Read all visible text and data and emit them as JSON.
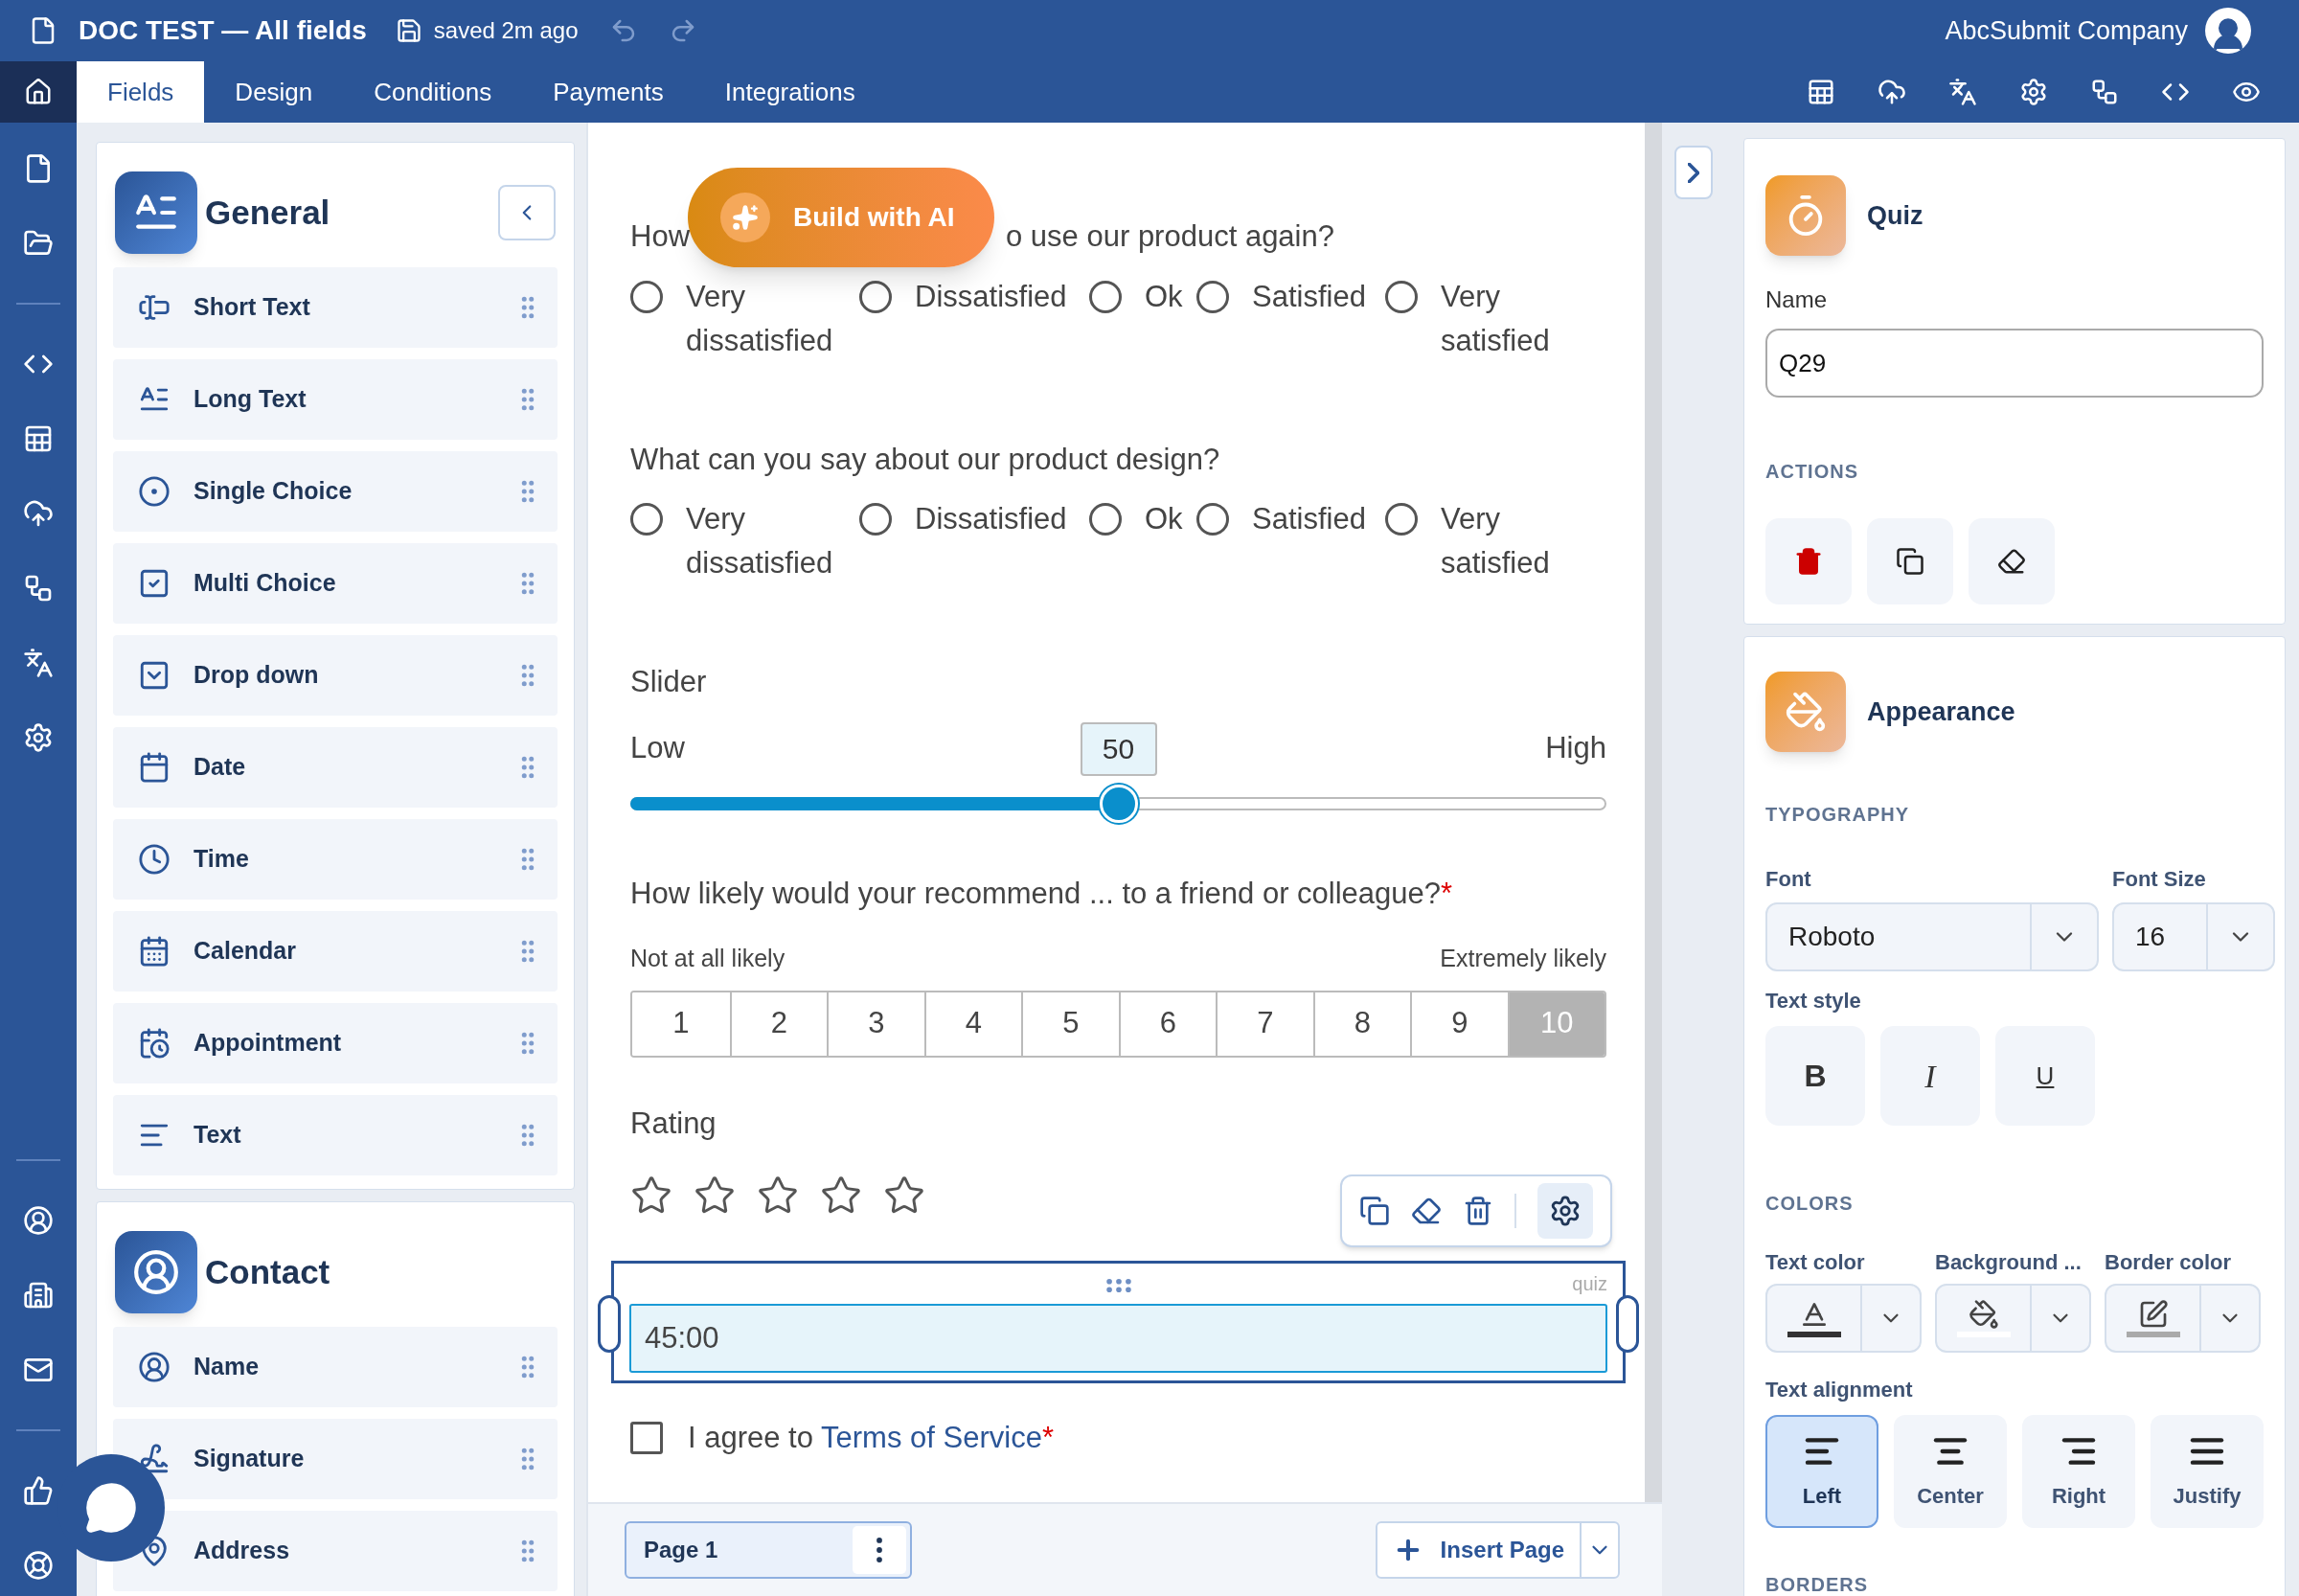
{
  "header": {
    "title": "DOC TEST — All fields",
    "save_status": "saved 2m ago",
    "account": "AbcSubmit Company"
  },
  "nav_tabs": [
    {
      "label": "Fields",
      "selected": true
    },
    {
      "label": "Design",
      "selected": false
    },
    {
      "label": "Conditions",
      "selected": false
    },
    {
      "label": "Payments",
      "selected": false
    },
    {
      "label": "Integrations",
      "selected": false
    }
  ],
  "left_panel": [
    {
      "title": "General",
      "items": [
        "Short Text",
        "Long Text",
        "Single Choice",
        "Multi Choice",
        "Drop down",
        "Date",
        "Time",
        "Calendar",
        "Appointment",
        "Text"
      ]
    },
    {
      "title": "Contact",
      "items": [
        "Name",
        "Signature",
        "Address"
      ]
    }
  ],
  "center": {
    "ai_button": "Build with AI",
    "blocks": [
      {
        "kind": "radio",
        "question_parts": [
          "How",
          "o use our product again?"
        ],
        "options": [
          {
            "label": "Very dissatisfied",
            "selected": false
          },
          {
            "label": "Dissatisfied",
            "selected": false
          },
          {
            "label": "Ok",
            "selected": false
          },
          {
            "label": "Satisfied",
            "selected": false
          },
          {
            "label": "Very satisfied",
            "selected": false
          }
        ]
      },
      {
        "kind": "radio",
        "question_parts": [
          "What can you say about our product design?"
        ],
        "options": [
          {
            "label": "Very dissatisfied",
            "selected": false
          },
          {
            "label": "Dissatisfied",
            "selected": false
          },
          {
            "label": "Ok",
            "selected": false
          },
          {
            "label": "Satisfied",
            "selected": false
          },
          {
            "label": "Very satisfied",
            "selected": false
          }
        ]
      },
      {
        "kind": "slider",
        "label": "Slider",
        "min_label": "Low",
        "max_label": "High",
        "value": "50",
        "level": 0.5
      },
      {
        "kind": "scale",
        "question": "How likely would your recommend ... to a friend or colleague?",
        "required_mark": "*",
        "low_label": "Not at all likely",
        "high_label": "Extremely likely",
        "options": [
          {
            "label": "1",
            "selected": false
          },
          {
            "label": "2",
            "selected": false
          },
          {
            "label": "3",
            "selected": false
          },
          {
            "label": "4",
            "selected": false
          },
          {
            "label": "5",
            "selected": false
          },
          {
            "label": "6",
            "selected": false
          },
          {
            "label": "7",
            "selected": false
          },
          {
            "label": "8",
            "selected": false
          },
          {
            "label": "9",
            "selected": false
          },
          {
            "label": "10",
            "selected": true
          }
        ]
      },
      {
        "kind": "rating",
        "label": "Rating",
        "stars": 0
      },
      {
        "kind": "quiz",
        "tag": "quiz",
        "value": "45:00",
        "selected": true
      },
      {
        "kind": "checkbox",
        "text_before": "I agree to ",
        "link": "Terms of Service",
        "required_mark": "*",
        "checked": false
      }
    ],
    "footer": {
      "page_tab": "Page 1",
      "insert_button": "Insert Page"
    }
  },
  "right_panel": {
    "quiz": {
      "title": "Quiz",
      "name_label": "Name",
      "name_value": "Q29",
      "actions_heading": "ACTIONS"
    },
    "appearance": {
      "title": "Appearance",
      "typography_heading": "TYPOGRAPHY",
      "font_label": "Font",
      "font_value": "Roboto",
      "size_label": "Font Size",
      "size_value": "16",
      "text_style_label": "Text style",
      "styles": [
        {
          "label": "B",
          "kind": "bold"
        },
        {
          "label": "I",
          "kind": "italic"
        },
        {
          "label": "U",
          "kind": "underline"
        }
      ],
      "colors_heading": "COLORS",
      "colors": [
        {
          "label": "Text color",
          "color": "#333333"
        },
        {
          "label": "Background ...",
          "color": "#ffffff"
        },
        {
          "label": "Border color",
          "color": "#aaaaaa"
        }
      ],
      "alignment_label": "Text alignment",
      "alignments": [
        {
          "label": "Left",
          "selected": true
        },
        {
          "label": "Center",
          "selected": false
        },
        {
          "label": "Right",
          "selected": false
        },
        {
          "label": "Justify",
          "selected": false
        }
      ],
      "borders_heading": "BORDERS"
    }
  }
}
